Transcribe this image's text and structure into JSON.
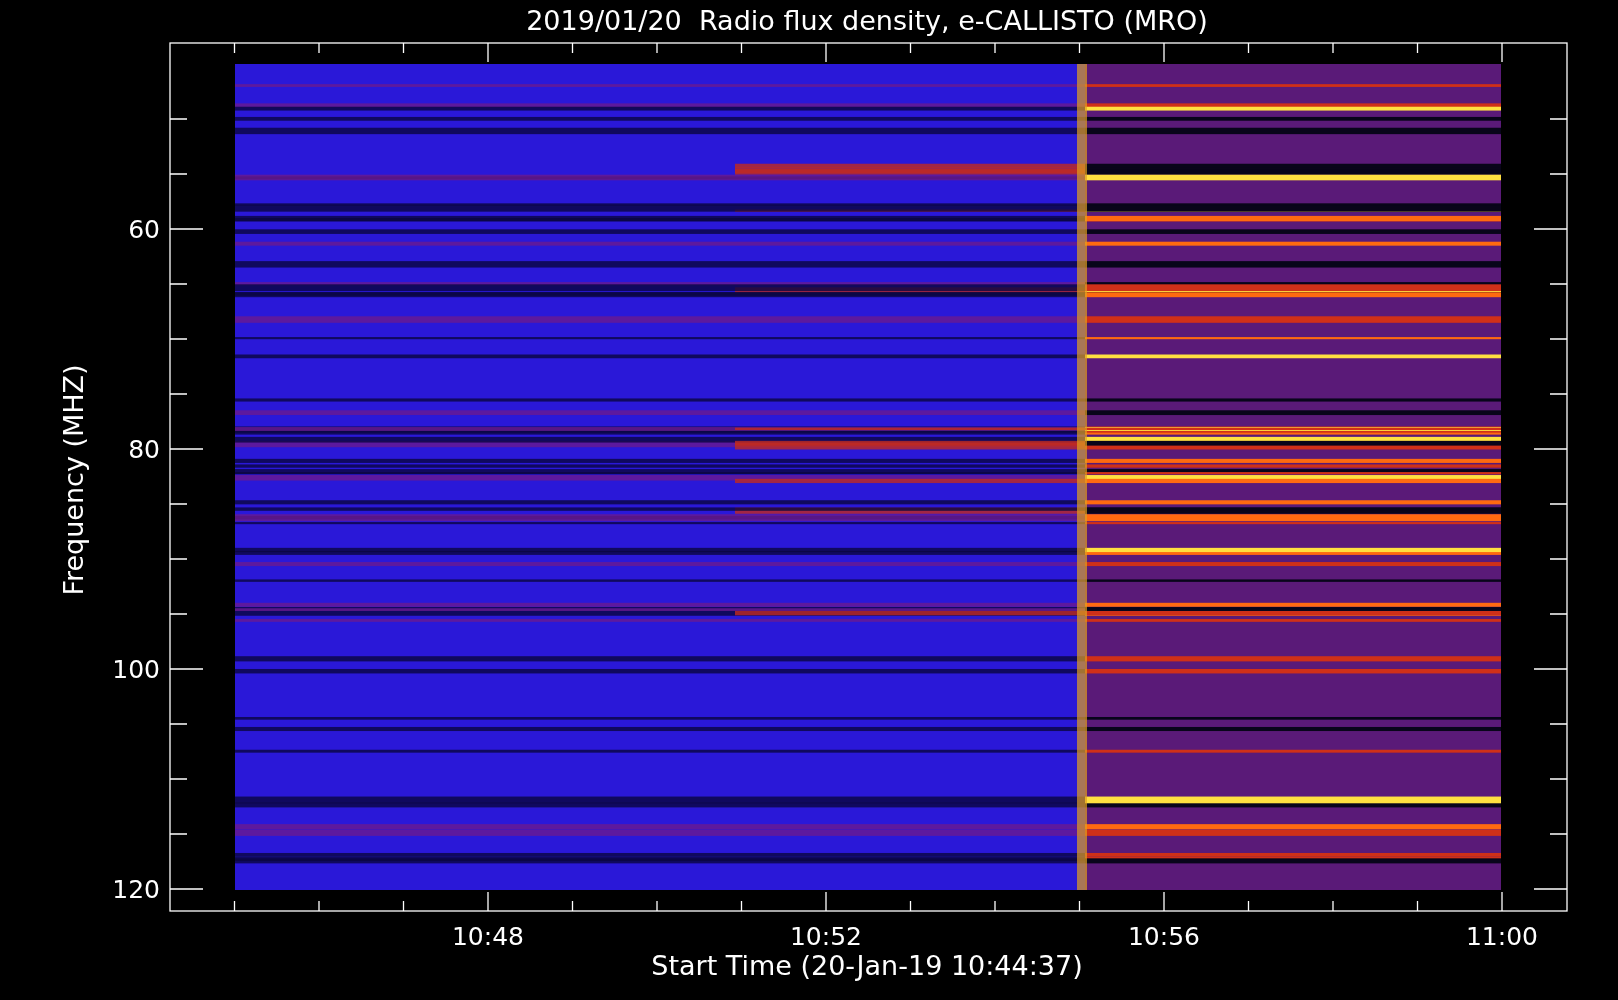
{
  "plot": {
    "title": "2019/01/20  Radio flux density, e-CALLISTO (MRO)",
    "y_axis": {
      "label": "Frequency (MHZ)",
      "ticks": [
        "60",
        "80",
        "100",
        "120"
      ]
    },
    "x_axis": {
      "label": "Start Time (20-Jan-19 10:44:37)",
      "ticks": [
        "10:48",
        "10:52",
        "10:56",
        "11:00"
      ]
    }
  }
}
